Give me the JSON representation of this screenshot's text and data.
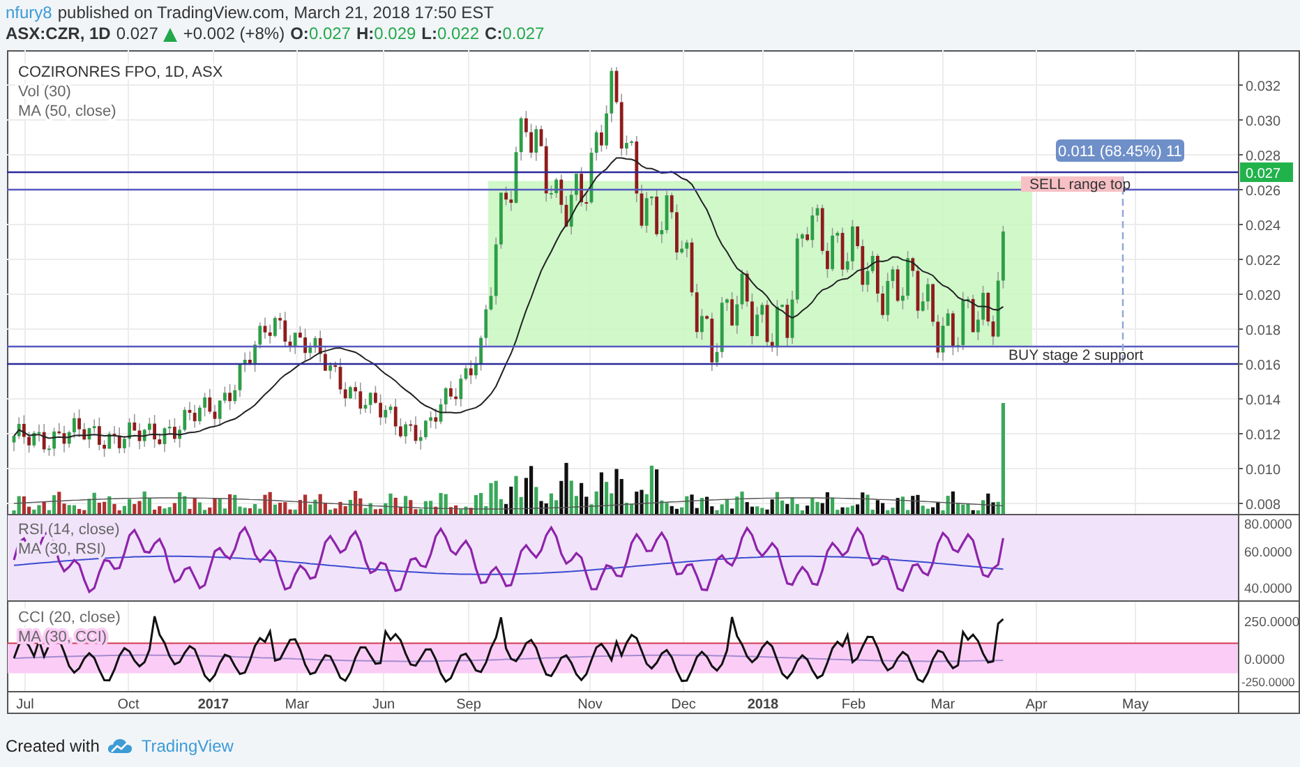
{
  "header": {
    "author": "nfury8",
    "published": "published on TradingView.com, March 21, 2018 17:50 EST"
  },
  "quote": {
    "symbol": "ASX:CZR, 1D",
    "last": "0.027",
    "rising": true,
    "change": "+0.002 (+8%)",
    "ohlc": [
      {
        "label": "O:",
        "value": "0.027"
      },
      {
        "label": "H:",
        "value": "0.029"
      },
      {
        "label": "L:",
        "value": "0.022"
      },
      {
        "label": "C:",
        "value": "0.027"
      }
    ]
  },
  "price_pane": {
    "legend": [
      "COZIRONRES FPO, 1D, ASX",
      "Vol (30)",
      "MA (50, close)"
    ],
    "ticks": [
      "0.032",
      "0.030",
      "0.028",
      "0.026",
      "0.024",
      "0.022",
      "0.020",
      "0.018",
      "0.016",
      "0.014",
      "0.012",
      "0.010",
      "0.008"
    ],
    "last_price_tag": "0.027",
    "sell_label": "SELL range top",
    "buy_label": "BUY stage 2 support",
    "measure_label": "0.011 (68.45%) 11"
  },
  "rsi_pane": {
    "legend": [
      "RSI (14, close)",
      "MA (30, RSI)"
    ],
    "ticks": [
      "80.0000",
      "60.0000",
      "40.0000"
    ]
  },
  "cci_pane": {
    "legend": [
      "CCI (20, close)",
      "MA (30, CCI)"
    ],
    "ticks": [
      "250.0000",
      "0.0000",
      "-250.0000"
    ]
  },
  "time_axis": [
    {
      "label": "Jul",
      "kind": "month"
    },
    {
      "label": "Oct",
      "kind": "month"
    },
    {
      "label": "2017",
      "kind": "year"
    },
    {
      "label": "Mar",
      "kind": "month"
    },
    {
      "label": "Jun",
      "kind": "month"
    },
    {
      "label": "Sep",
      "kind": "month"
    },
    {
      "label": "Nov",
      "kind": "month"
    },
    {
      "label": "Dec",
      "kind": "month"
    },
    {
      "label": "2018",
      "kind": "year"
    },
    {
      "label": "Feb",
      "kind": "month"
    },
    {
      "label": "Mar",
      "kind": "month"
    },
    {
      "label": "Apr",
      "kind": "month"
    },
    {
      "label": "May",
      "kind": "month"
    }
  ],
  "footer": {
    "text": "Created with",
    "brand": "TradingView"
  }
}
